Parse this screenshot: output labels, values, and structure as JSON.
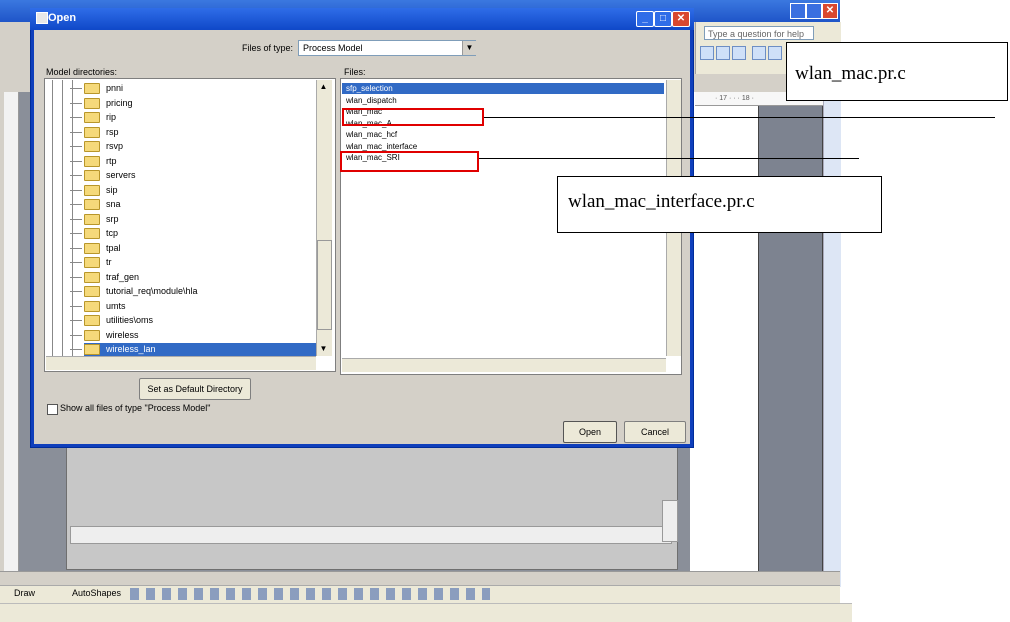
{
  "dialog": {
    "title": "Open",
    "files_of_type_label": "Files of type:",
    "files_of_type_value": "Process Model",
    "model_directories_label": "Model directories:",
    "files_label": "Files:",
    "directories": [
      "pnni",
      "pricing",
      "rip",
      "rsp",
      "rsvp",
      "rtp",
      "servers",
      "sip",
      "sna",
      "srp",
      "tcp",
      "tpal",
      "tr",
      "traf_gen",
      "tutorial_req\\module\\hla",
      "umts",
      "utilities\\oms",
      "wireless",
      "wireless_lan"
    ],
    "selected_directory": "wireless_lan",
    "files": [
      "sfp_selection",
      "wlan_dispatch",
      "wlan_mac",
      "wlan_mac_A",
      "wlan_mac_hcf",
      "wlan_mac_interface",
      "wlan_mac_SRI"
    ],
    "selected_file": "sfp_selection",
    "set_default_label": "Set as Default Directory",
    "show_all_label": "Show all files of type \"Process Model\"",
    "open_label": "Open",
    "cancel_label": "Cancel"
  },
  "word": {
    "help_placeholder": "Type a question for help",
    "draw_label": "Draw",
    "autoshapes_label": "AutoShapes",
    "ruler_text": "· 17 · · · 18 ·"
  },
  "callouts": {
    "first": "wlan_mac.pr.c",
    "second": "wlan_mac_interface.pr.c"
  },
  "colors": {
    "highlight": "#e00000",
    "selection": "#316ac5",
    "title_bar": "#0f48c8"
  }
}
